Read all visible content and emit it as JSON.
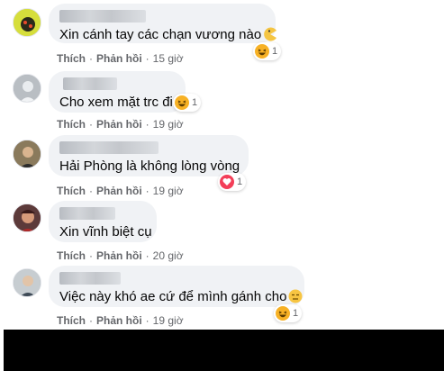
{
  "comments": [
    {
      "text": "Xin cánh tay các chạn vương nào",
      "inline_emoji": "pacman-icon",
      "reaction_icon": "haha-icon",
      "reaction_count": "1",
      "like": "Thích",
      "reply": "Phản hồi",
      "time": "15 giờ"
    },
    {
      "text": "Cho xem mặt trc đi",
      "reaction_icon": "haha-icon",
      "reaction_count": "1",
      "like": "Thích",
      "reply": "Phản hồi",
      "time": "19 giờ"
    },
    {
      "text": "Hải Phòng là không lòng vòng",
      "reaction_icon": "love-icon",
      "reaction_count": "1",
      "like": "Thích",
      "reply": "Phản hồi",
      "time": "19 giờ"
    },
    {
      "text": "Xin vĩnh biệt cụ",
      "like": "Thích",
      "reply": "Phản hồi",
      "time": "20 giờ"
    },
    {
      "text": "Việc này khó ae cứ để mình gánh cho",
      "inline_emoji": "expressionless-face-icon",
      "reaction_icon": "haha-icon",
      "reaction_count": "1",
      "like": "Thích",
      "reply": "Phản hồi",
      "time": "19 giờ"
    }
  ],
  "separator": "·",
  "colors": {
    "bubble": "#f0f2f5",
    "meta_text": "#65676b",
    "love": "#f33e58",
    "haha": "#f7b125"
  }
}
